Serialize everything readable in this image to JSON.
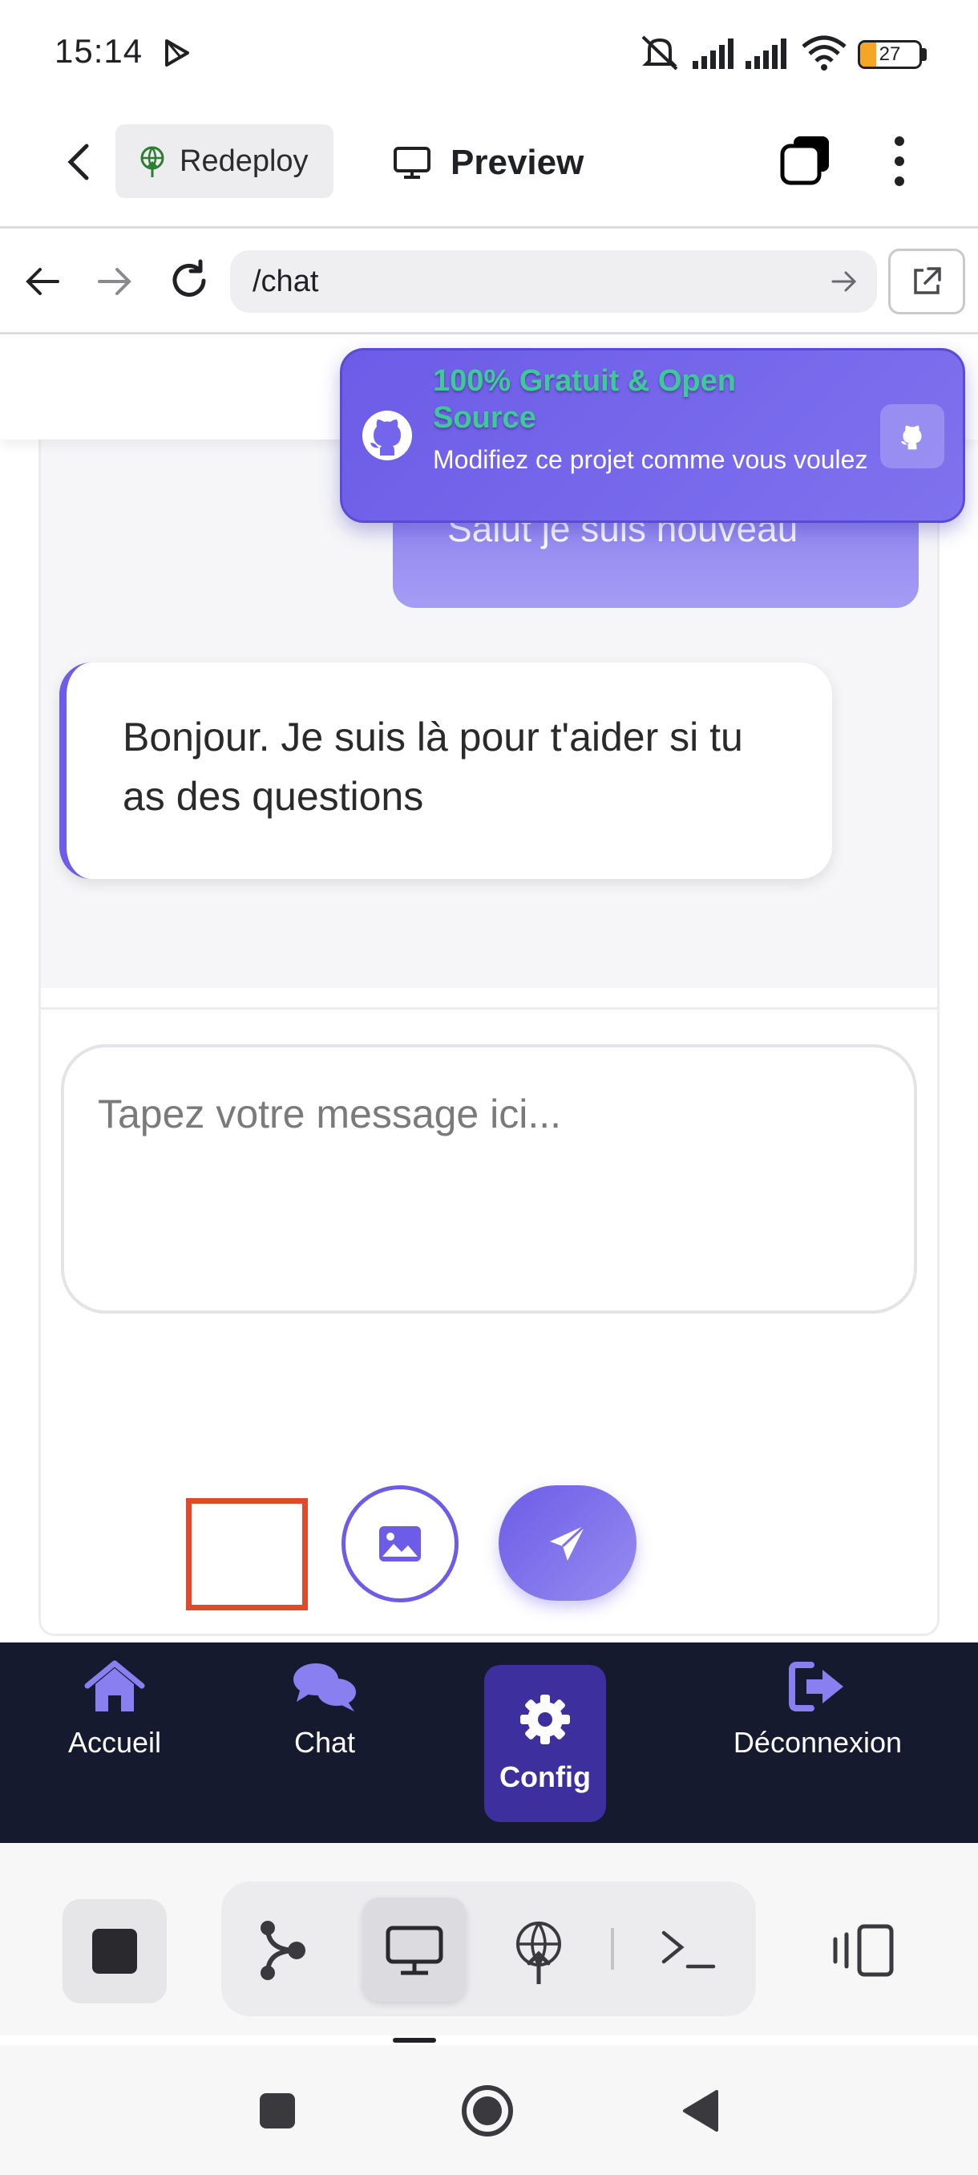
{
  "status_bar": {
    "time": "15:14",
    "battery": "27"
  },
  "app_bar": {
    "redeploy_label": "Redeploy",
    "preview_label": "Preview"
  },
  "browser": {
    "url": "/chat"
  },
  "chat": {
    "user_message": "Salut je suis nouveau",
    "bot_message": "Bonjour. Je suis là pour t'aider si tu as des questions",
    "input_placeholder": "Tapez votre message ici..."
  },
  "toast": {
    "title": "100% Gratuit & Open Source",
    "subtitle": "Modifiez ce projet comme vous voulez"
  },
  "nav": {
    "items": [
      {
        "label": "Accueil",
        "icon": "home-icon"
      },
      {
        "label": "Chat",
        "icon": "chat-icon"
      },
      {
        "label": "Config",
        "icon": "gear-icon",
        "active": true
      },
      {
        "label": "Déconnexion",
        "icon": "logout-icon"
      }
    ]
  },
  "colors": {
    "accent": "#6c5ce7",
    "nav_bg": "#161a2e",
    "active_bg": "#3d2f9e",
    "toast_title": "#3fc99a"
  }
}
